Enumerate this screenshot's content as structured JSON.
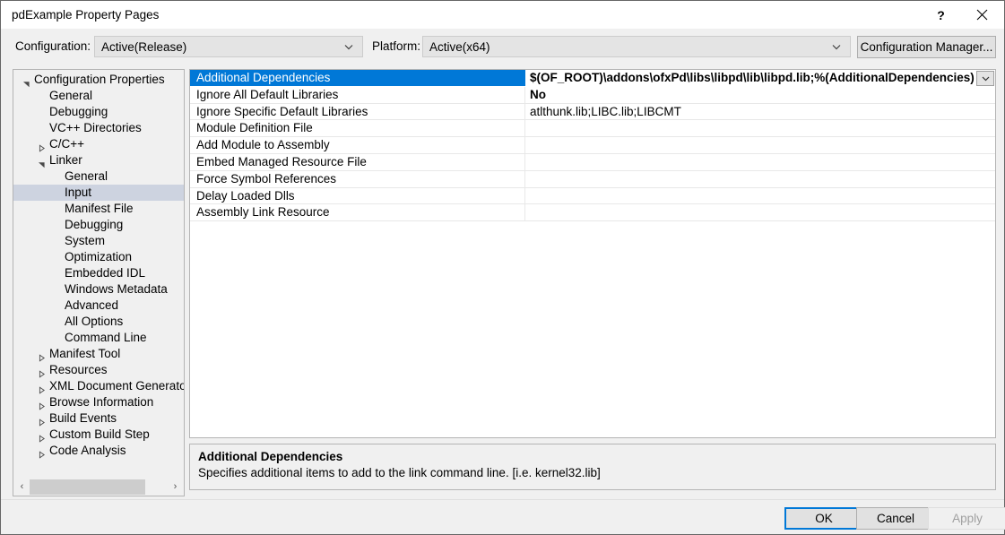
{
  "window": {
    "title": "pdExample Property Pages",
    "help_icon": "?",
    "close_icon": "close-icon"
  },
  "config_bar": {
    "configuration_label": "Configuration:",
    "configuration_value": "Active(Release)",
    "platform_label": "Platform:",
    "platform_value": "Active(x64)",
    "configuration_manager_label": "Configuration Manager..."
  },
  "tree": {
    "selected": "Input",
    "nodes": [
      {
        "label": "Configuration Properties",
        "indent": 0,
        "state": "expanded"
      },
      {
        "label": "General",
        "indent": 1,
        "state": "leaf"
      },
      {
        "label": "Debugging",
        "indent": 1,
        "state": "leaf"
      },
      {
        "label": "VC++ Directories",
        "indent": 1,
        "state": "leaf"
      },
      {
        "label": "C/C++",
        "indent": 1,
        "state": "collapsed"
      },
      {
        "label": "Linker",
        "indent": 1,
        "state": "expanded"
      },
      {
        "label": "General",
        "indent": 2,
        "state": "leaf"
      },
      {
        "label": "Input",
        "indent": 2,
        "state": "leaf",
        "selected": true
      },
      {
        "label": "Manifest File",
        "indent": 2,
        "state": "leaf"
      },
      {
        "label": "Debugging",
        "indent": 2,
        "state": "leaf"
      },
      {
        "label": "System",
        "indent": 2,
        "state": "leaf"
      },
      {
        "label": "Optimization",
        "indent": 2,
        "state": "leaf"
      },
      {
        "label": "Embedded IDL",
        "indent": 2,
        "state": "leaf"
      },
      {
        "label": "Windows Metadata",
        "indent": 2,
        "state": "leaf"
      },
      {
        "label": "Advanced",
        "indent": 2,
        "state": "leaf"
      },
      {
        "label": "All Options",
        "indent": 2,
        "state": "leaf"
      },
      {
        "label": "Command Line",
        "indent": 2,
        "state": "leaf"
      },
      {
        "label": "Manifest Tool",
        "indent": 1,
        "state": "collapsed"
      },
      {
        "label": "Resources",
        "indent": 1,
        "state": "collapsed"
      },
      {
        "label": "XML Document Generator",
        "indent": 1,
        "state": "collapsed"
      },
      {
        "label": "Browse Information",
        "indent": 1,
        "state": "collapsed"
      },
      {
        "label": "Build Events",
        "indent": 1,
        "state": "collapsed"
      },
      {
        "label": "Custom Build Step",
        "indent": 1,
        "state": "collapsed"
      },
      {
        "label": "Code Analysis",
        "indent": 1,
        "state": "collapsed"
      }
    ],
    "scrollbar": {
      "left_arrow": "‹",
      "right_arrow": "›"
    }
  },
  "grid": {
    "rows": [
      {
        "name": "Additional Dependencies",
        "value": "$(OF_ROOT)\\addons\\ofxPd\\libs\\libpd\\lib\\libpd.lib;%(AdditionalDependencies)",
        "selected": true,
        "bold": true,
        "has_dropdown": true
      },
      {
        "name": "Ignore All Default Libraries",
        "value": "No",
        "bold": true
      },
      {
        "name": "Ignore Specific Default Libraries",
        "value": "atlthunk.lib;LIBC.lib;LIBCMT"
      },
      {
        "name": "Module Definition File",
        "value": ""
      },
      {
        "name": "Add Module to Assembly",
        "value": ""
      },
      {
        "name": "Embed Managed Resource File",
        "value": ""
      },
      {
        "name": "Force Symbol References",
        "value": ""
      },
      {
        "name": "Delay Loaded Dlls",
        "value": ""
      },
      {
        "name": "Assembly Link Resource",
        "value": ""
      }
    ]
  },
  "description": {
    "title": "Additional Dependencies",
    "text": "Specifies additional items to add to the link command line. [i.e. kernel32.lib]"
  },
  "footer": {
    "ok_label": "OK",
    "cancel_label": "Cancel",
    "apply_label": "Apply"
  },
  "colors": {
    "selection_blue": "#0078d7",
    "tree_selection": "#cdd3e0",
    "dialog_bg": "#f0f0f0"
  }
}
